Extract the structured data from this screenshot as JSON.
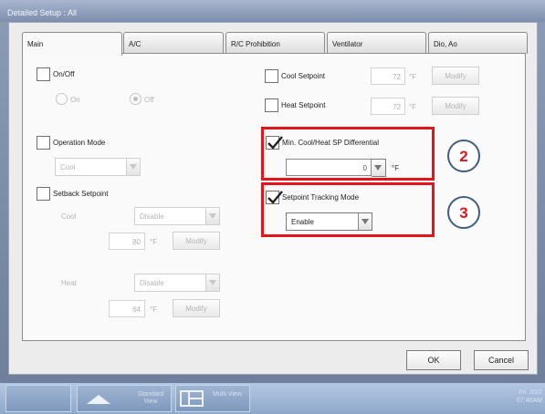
{
  "window": {
    "title": "Detailed Setup : All"
  },
  "tabs": [
    "Main",
    "A/C",
    "R/C Prohibition",
    "Ventilator",
    "Dio, Ao"
  ],
  "onoff": {
    "label": "On/Off",
    "radio_on": "On",
    "radio_off": "Off"
  },
  "operation_mode": {
    "label": "Operation Mode",
    "value": "Cool"
  },
  "setback": {
    "label": "Setback Setpoint",
    "cool_label": "Cool",
    "cool_dropdown": "Disable",
    "cool_value": "80",
    "heat_label": "Heat",
    "heat_dropdown": "Disable",
    "heat_value": "64",
    "unit": "°F",
    "modify": "Modify"
  },
  "cool_setpoint": {
    "label": "Cool Setpoint",
    "value": "72",
    "unit": "°F",
    "modify": "Modify"
  },
  "heat_setpoint": {
    "label": "Heat Setpoint",
    "value": "72",
    "unit": "°F",
    "modify": "Modify"
  },
  "min_diff": {
    "label": "Min. Cool/Heat SP Differential",
    "value": "0",
    "unit": "°F"
  },
  "tracking": {
    "label": "Setpoint Tracking Mode",
    "value": "Enable"
  },
  "markers": [
    "2",
    "3"
  ],
  "footer": {
    "ok": "OK",
    "cancel": "Cancel"
  },
  "taskbar": {
    "standard_view": "Standard View",
    "multi_view": "Multi View",
    "date": "Fri. 05/2",
    "time": "07:40AM"
  },
  "colors": {
    "highlight": "#e5141b",
    "marker_border": "#3e5e86"
  }
}
